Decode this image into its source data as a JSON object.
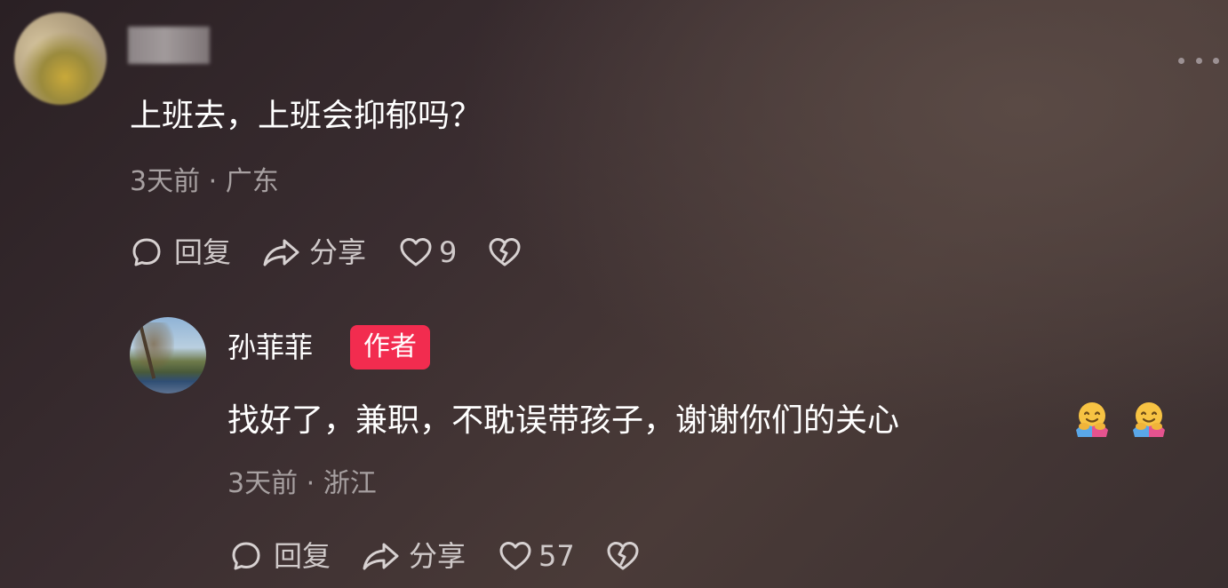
{
  "comment": {
    "text": "上班去，上班会抑郁吗？",
    "meta": "3天前 · 广东",
    "actions": {
      "reply_label": "回复",
      "share_label": "分享",
      "like_count": "9"
    }
  },
  "reply": {
    "author_name": "孙菲菲",
    "author_badge": "作者",
    "text": "找好了，兼职，不耽误带孩子，谢谢你们的关心",
    "meta": "3天前 · 浙江",
    "actions": {
      "reply_label": "回复",
      "share_label": "分享",
      "like_count": "57"
    },
    "emojis": [
      "hugging-face-emoji",
      "hugging-face-emoji"
    ]
  },
  "colors": {
    "badge_bg": "#f22c4f",
    "text_primary": "#ffffff",
    "text_secondary": "#a7a0a1",
    "action_text": "#cfc9c9"
  }
}
